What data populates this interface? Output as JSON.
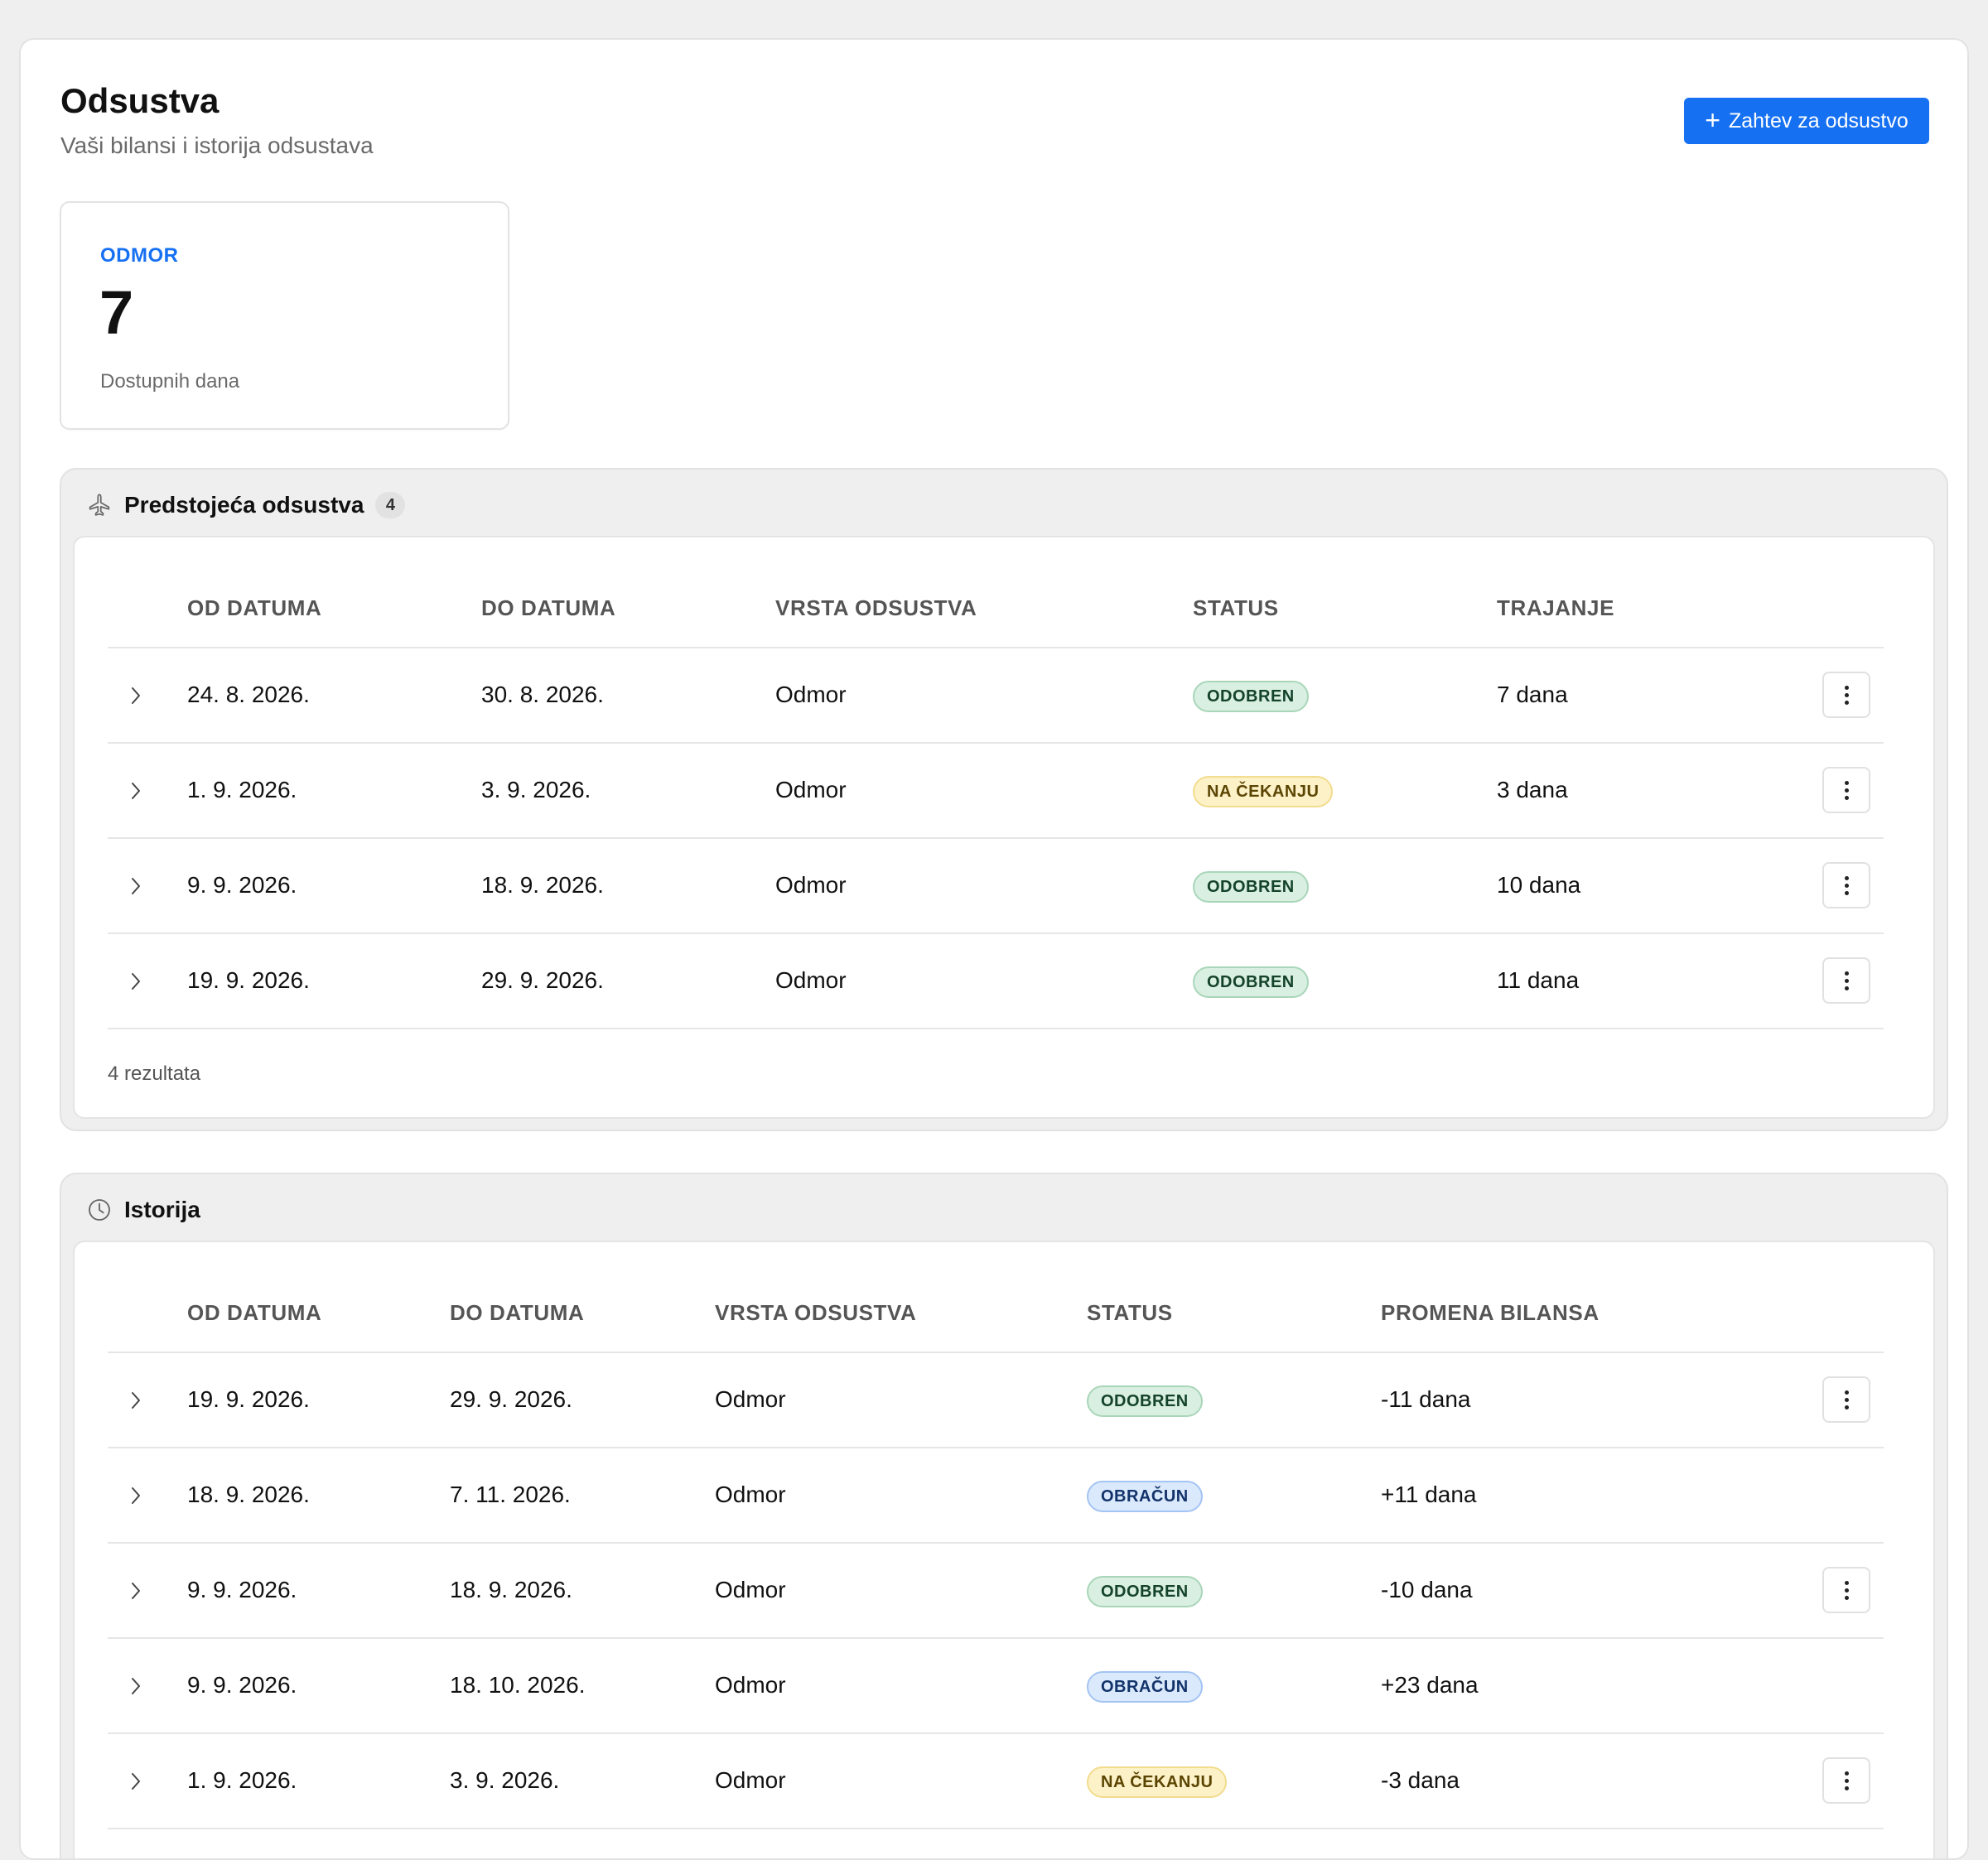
{
  "header": {
    "title": "Odsustva",
    "subtitle": "Vaši bilansi i istorija odsustava",
    "request_button_label": "Zahtev za odsustvo"
  },
  "balance": {
    "type": "ODMOR",
    "value": "7",
    "label": "Dostupnih dana"
  },
  "upcoming": {
    "title": "Predstojeća odsustva",
    "count": "4",
    "columns": [
      "OD DATUMA",
      "DO DATUMA",
      "VRSTA ODSUSTVA",
      "STATUS",
      "TRAJANJE"
    ],
    "rows": [
      {
        "from": "24. 8. 2026.",
        "to": "30. 8. 2026.",
        "type": "Odmor",
        "status": "ODOBREN",
        "status_kind": "approved",
        "value": "7 dana"
      },
      {
        "from": "1. 9. 2026.",
        "to": "3. 9. 2026.",
        "type": "Odmor",
        "status": "NA ČEKANJU",
        "status_kind": "pending",
        "value": "3 dana"
      },
      {
        "from": "9. 9. 2026.",
        "to": "18. 9. 2026.",
        "type": "Odmor",
        "status": "ODOBREN",
        "status_kind": "approved",
        "value": "10 dana"
      },
      {
        "from": "19. 9. 2026.",
        "to": "29. 9. 2026.",
        "type": "Odmor",
        "status": "ODOBREN",
        "status_kind": "approved",
        "value": "11 dana"
      }
    ],
    "footer": "4 rezultata"
  },
  "history": {
    "title": "Istorija",
    "columns": [
      "OD DATUMA",
      "DO DATUMA",
      "VRSTA ODSUSTVA",
      "STATUS",
      "PROMENA BILANSA"
    ],
    "rows": [
      {
        "from": "19. 9. 2026.",
        "to": "29. 9. 2026.",
        "type": "Odmor",
        "status": "ODOBREN",
        "status_kind": "approved",
        "value": "-11 dana",
        "has_menu": true
      },
      {
        "from": "18. 9. 2026.",
        "to": "7. 11. 2026.",
        "type": "Odmor",
        "status": "OBRAČUN",
        "status_kind": "accrual",
        "value": "+11 dana",
        "has_menu": false
      },
      {
        "from": "9. 9. 2026.",
        "to": "18. 9. 2026.",
        "type": "Odmor",
        "status": "ODOBREN",
        "status_kind": "approved",
        "value": "-10 dana",
        "has_menu": true
      },
      {
        "from": "9. 9. 2026.",
        "to": "18. 10. 2026.",
        "type": "Odmor",
        "status": "OBRAČUN",
        "status_kind": "accrual",
        "value": "+23 dana",
        "has_menu": false
      },
      {
        "from": "1. 9. 2026.",
        "to": "3. 9. 2026.",
        "type": "Odmor",
        "status": "NA ČEKANJU",
        "status_kind": "pending",
        "value": "-3 dana",
        "has_menu": true
      }
    ]
  },
  "icons": {
    "upcoming": "airplane-icon",
    "history": "clock-icon",
    "row_expand": "chevron-right-icon",
    "row_menu": "kebab-menu-icon",
    "add": "plus-icon"
  },
  "colors": {
    "accent": "#1670f2",
    "approved_bg": "#d9efe2",
    "pending_bg": "#fdf1c8",
    "accrual_bg": "#dbe9fc"
  }
}
